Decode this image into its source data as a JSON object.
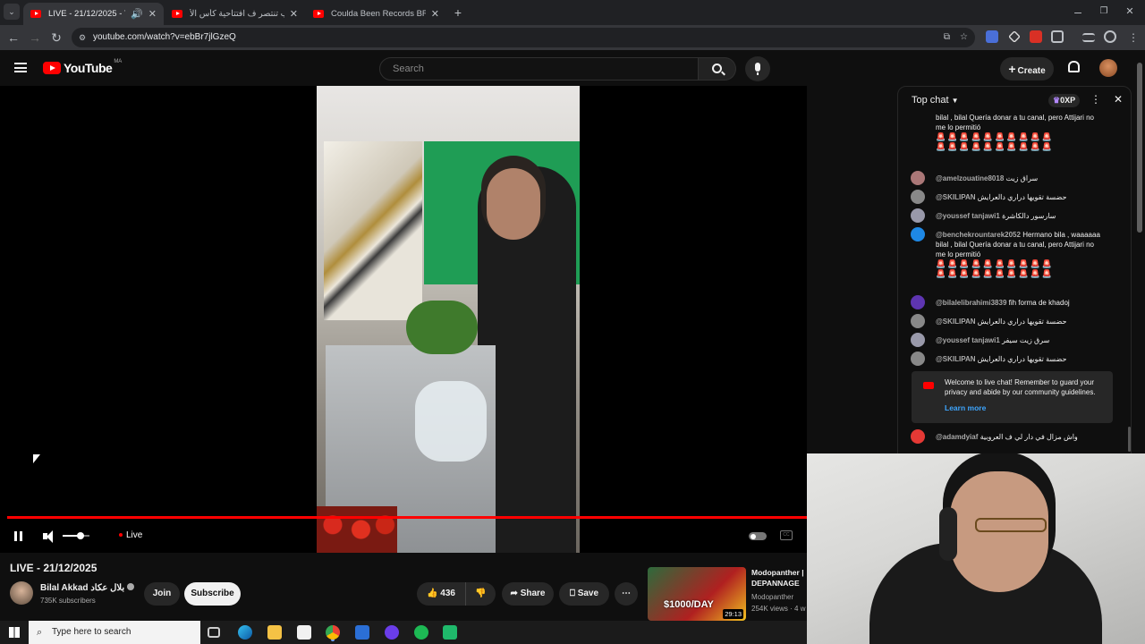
{
  "browser": {
    "tabs": [
      {
        "title": "LIVE - 21/12/2025 - YouTub",
        "active": true
      },
      {
        "title": "المغرب تنتصر ف افتتاحية كأس الأ",
        "active": false
      },
      {
        "title": "Coulda Been Records BROOKLY",
        "active": false
      }
    ],
    "url": "youtube.com/watch?v=ebBr7jlGzeQ"
  },
  "youtube": {
    "logo": "YouTube",
    "region": "MA",
    "search_placeholder": "Search",
    "create_label": "Create"
  },
  "player": {
    "live_label": "Live"
  },
  "video": {
    "title": "LIVE - 21/12/2025",
    "channel_name": "Bilal Akkad",
    "channel_name_ar": "بلال عكاد",
    "subscribers": "735K subscribers",
    "join_label": "Join",
    "subscribe_label": "Subscribe",
    "likes": "436",
    "share_label": "Share",
    "save_label": "Save"
  },
  "chat": {
    "header": "Top chat",
    "xp": "0XP",
    "welcome_text": "Welcome to live chat! Remember to guard your privacy and abide by our community guidelines.",
    "learn_more": "Learn more",
    "messages": [
      {
        "author": "",
        "text": "bilal , bilal Quería donar a tu canal, pero Attijari no me lo permitió",
        "avatar_color": "#5b8"
      },
      {
        "author": "@amelzouatine8018",
        "text": "سراق زيت",
        "avatar_color": "#a77"
      },
      {
        "author": "@SKILIPAN",
        "text": "حضسة تقويها دراري دالعرايش",
        "avatar_color": "#888"
      },
      {
        "author": "@youssef tanjawi1",
        "text": "سارسور دالكاشرة",
        "avatar_color": "#99a"
      },
      {
        "author": "@benchekrountarek2052",
        "text": "Hermano bila , waaaaaa bilal , bilal Quería donar a tu canal, pero Attijari no me lo permitió",
        "avatar_color": "#1e88e5"
      },
      {
        "author": "@bilalelibrahimi3839",
        "text": "fih forma de khadoj",
        "avatar_color": "#5e35b1"
      },
      {
        "author": "@SKILIPAN",
        "text": "حضسة تقويها دراري دالعرايش",
        "avatar_color": "#888"
      },
      {
        "author": "@youssef tanjawi1",
        "text": "سرق زيت سيفر",
        "avatar_color": "#99a"
      },
      {
        "author": "@SKILIPAN",
        "text": "حضسة تقويها دراري دالعرايش",
        "avatar_color": "#888"
      },
      {
        "author": "@adamdyiaf",
        "text": "واش مزال في دار لي ف العروبية",
        "avatar_color": "#e53935"
      }
    ]
  },
  "recommended": {
    "channel": "Modopanther",
    "title": "Modopanther | DEPANNAGE",
    "views": "254K views · 4 w",
    "duration": "29:13",
    "thumb_text": "$1000/DAY"
  },
  "taskbar": {
    "search_placeholder": "Type here to search"
  },
  "colors": {
    "accent": "#ff0000",
    "background": "#0f0f0f"
  }
}
